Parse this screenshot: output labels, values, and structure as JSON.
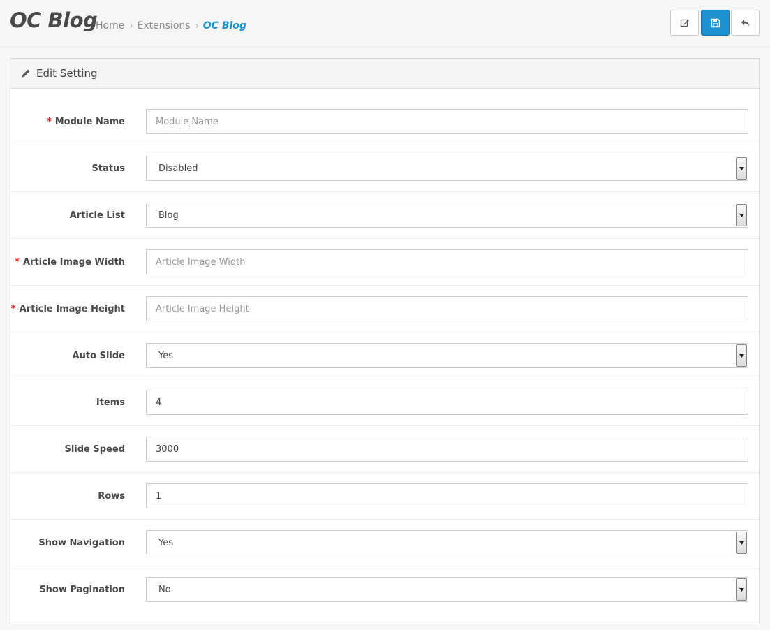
{
  "header": {
    "title": "OC Blog",
    "breadcrumb": [
      "Home",
      "Extensions",
      "OC Blog"
    ],
    "buttons": {
      "edit": "edit-icon",
      "save": "save-icon",
      "back": "reply-icon"
    }
  },
  "panel": {
    "heading": "Edit Setting",
    "heading_icon": "pencil-icon"
  },
  "form": {
    "module_name": {
      "label": "Module Name",
      "required": true,
      "value": "",
      "placeholder": "Module Name"
    },
    "status": {
      "label": "Status",
      "selected": "Disabled"
    },
    "article_list": {
      "label": "Article List",
      "selected": "Blog"
    },
    "article_image_width": {
      "label": "Article Image Width",
      "required": true,
      "value": "",
      "placeholder": "Article Image Width"
    },
    "article_image_height": {
      "label": "Article Image Height",
      "required": true,
      "value": "",
      "placeholder": "Article Image Height"
    },
    "auto_slide": {
      "label": "Auto Slide",
      "selected": "Yes"
    },
    "items": {
      "label": "Items",
      "value": "4",
      "placeholder": ""
    },
    "slide_speed": {
      "label": "Slide Speed",
      "value": "3000",
      "placeholder": ""
    },
    "rows": {
      "label": "Rows",
      "value": "1",
      "placeholder": ""
    },
    "show_navigation": {
      "label": "Show Navigation",
      "selected": "Yes"
    },
    "show_pagination": {
      "label": "Show Pagination",
      "selected": "No"
    }
  },
  "colors": {
    "primary": "#1e91cf",
    "required": "#ee1111"
  }
}
